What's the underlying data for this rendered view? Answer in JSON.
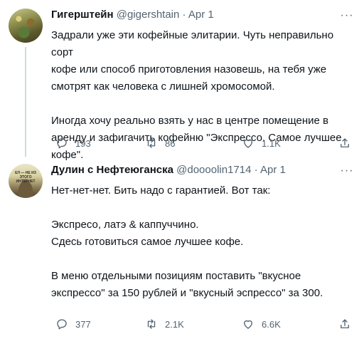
{
  "tweets": [
    {
      "author_name": "Гигерштейн",
      "handle": "@gigershtain",
      "separator": " · ",
      "date": "Apr 1",
      "paragraphs": [
        [
          "Задрали уже эти кофейные элитарии. Чуть неправильно сорт",
          "кофе или способ приготовления назовешь, на тебя уже",
          "смотрят как человека с лишней хромосомой."
        ],
        [
          "Иногда хочу реально взять у нас в центре помещение в",
          "аренду и зафигачить кофейню \"Экспрессо. Самое лучшее",
          "кофе\"."
        ]
      ],
      "replies": "193",
      "retweets": "86",
      "likes": "1.1K"
    },
    {
      "author_name": "Дулин с Нефтеюганска",
      "handle": "@doooolin1714",
      "separator": " · ",
      "date": "Apr 1",
      "avatar_caption": "ЕЛ — НЕ ИЗ ЭТОГО ИНТЕРНЕТ",
      "paragraphs": [
        [
          "Нет-нет-нет. Бить надо с гарантией. Вот так:"
        ],
        [
          "Экспресо, латэ & каппуччино.",
          "Сдесь готовиться самое лучшее кофе."
        ],
        [
          "В меню отдельными позициям поставить \"вкусное",
          "экспрессо\" за 150 рублей и \"вкусный эспрессо\" за 300."
        ]
      ],
      "replies": "377",
      "retweets": "2.1K",
      "likes": "6.6K"
    }
  ]
}
